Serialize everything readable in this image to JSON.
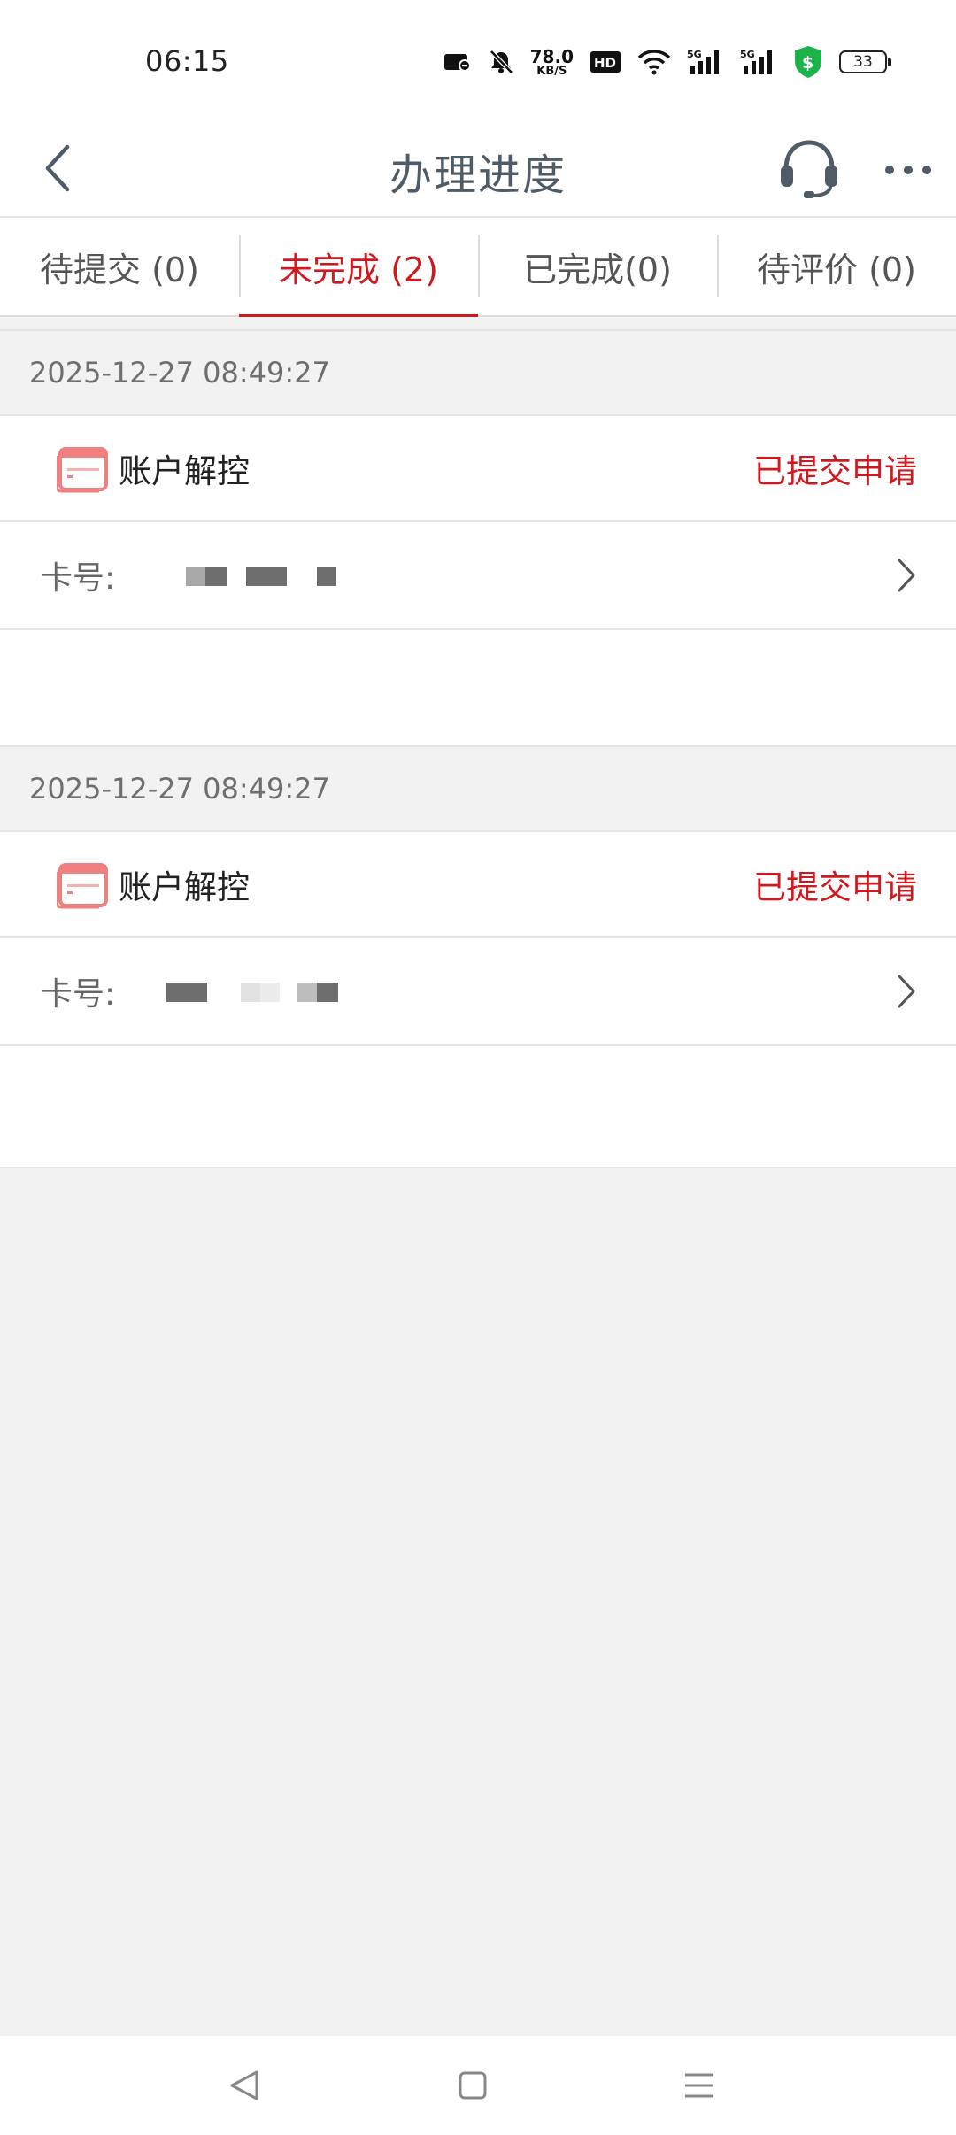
{
  "status_bar": {
    "time": "06:15",
    "net_speed_value": "78.0",
    "net_speed_unit": "KB/S",
    "battery_level": "33",
    "icons": [
      "screen-record-icon",
      "mute-icon",
      "net-speed",
      "hd-icon",
      "wifi-icon",
      "5g-signal-icon",
      "5g-signal-icon",
      "security-shield-icon",
      "battery-icon"
    ]
  },
  "header": {
    "title": "办理进度",
    "back_icon": "chevron-left-icon",
    "service_icon": "headset-icon",
    "more_icon": "more-dots-icon"
  },
  "tabs": [
    {
      "label": "待提交 (0)",
      "active": false
    },
    {
      "label": "未完成 (2)",
      "active": true
    },
    {
      "label": "已完成(0)",
      "active": false
    },
    {
      "label": "待评价 (0)",
      "active": false
    }
  ],
  "records": [
    {
      "datetime": "2025-12-27 08:49:27",
      "title": "账户解控",
      "status": "已提交申请",
      "card_label": "卡号:"
    },
    {
      "datetime": "2025-12-27 08:49:27",
      "title": "账户解控",
      "status": "已提交申请",
      "card_label": "卡号:"
    }
  ],
  "colors": {
    "accent": "#d0191f",
    "title": "#4f5b66",
    "card_icon": "#f08080",
    "background": "#f2f2f2"
  },
  "system_nav": [
    "back-triangle-icon",
    "home-square-icon",
    "menu-lines-icon"
  ]
}
